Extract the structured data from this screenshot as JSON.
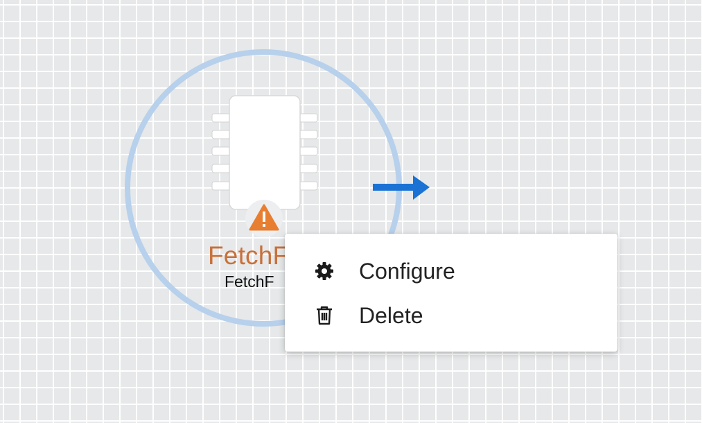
{
  "node": {
    "title": "FetchF",
    "subtitle": "FetchF",
    "status_icon": "warning-icon",
    "status_color": "#e87e30",
    "title_color": "#c8713a"
  },
  "selection": {
    "ring_color": "#b7d0ec"
  },
  "connection_handle": {
    "icon": "arrow-right-icon",
    "color": "#1a73d4"
  },
  "context_menu": {
    "items": [
      {
        "label": "Configure",
        "icon": "gear-icon"
      },
      {
        "label": "Delete",
        "icon": "trash-icon"
      }
    ]
  }
}
